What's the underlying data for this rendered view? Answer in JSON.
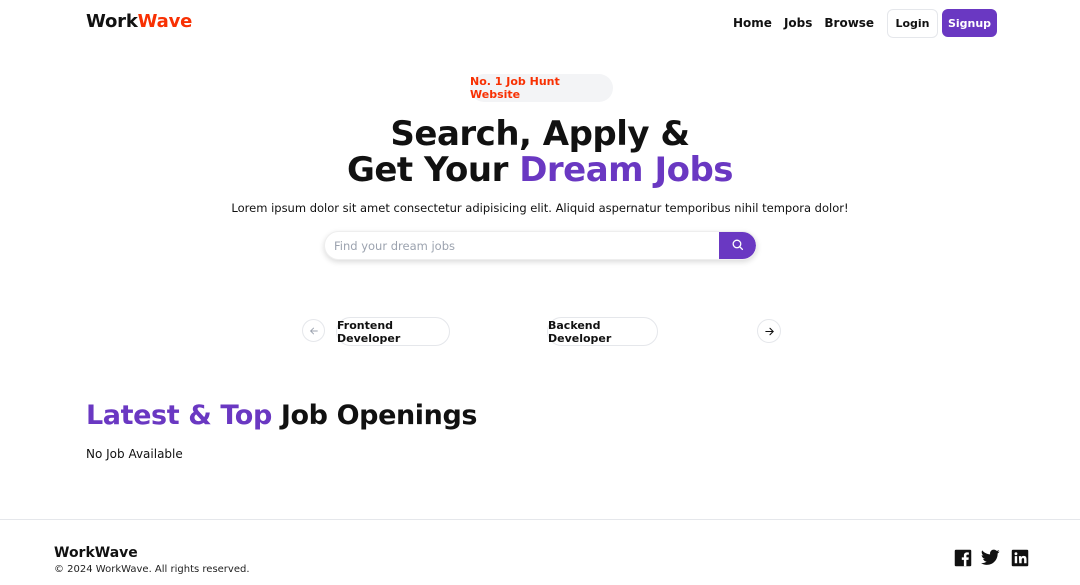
{
  "brand": {
    "name_part1": "Work",
    "name_part2": "Wave",
    "accent_color": "#f83002"
  },
  "nav": {
    "links": [
      "Home",
      "Jobs",
      "Browse"
    ],
    "login_label": "Login",
    "signup_label": "Signup"
  },
  "hero": {
    "badge": "No. 1 Job Hunt Website",
    "title_line1": "Search, Apply &",
    "title_line2_prefix": "Get Your ",
    "title_line2_accent": "Dream Jobs",
    "subtitle": "Lorem ipsum dolor sit amet consectetur adipisicing elit. Aliquid aspernatur temporibus nihil tempora dolor!",
    "search_placeholder": "Find your dream jobs",
    "search_value": "",
    "primary_color": "#6a38c2"
  },
  "carousel": {
    "items": [
      "Frontend Developer",
      "Backend Developer"
    ],
    "prev_icon": "arrow-left-icon",
    "next_icon": "arrow-right-icon"
  },
  "latest": {
    "title_accent": "Latest & Top",
    "title_rest": " Job Openings",
    "empty_text": "No Job Available"
  },
  "footer": {
    "brand": "WorkWave",
    "copyright": "© 2024 WorkWave. All rights reserved.",
    "social": [
      "facebook-icon",
      "twitter-icon",
      "linkedin-icon"
    ]
  }
}
